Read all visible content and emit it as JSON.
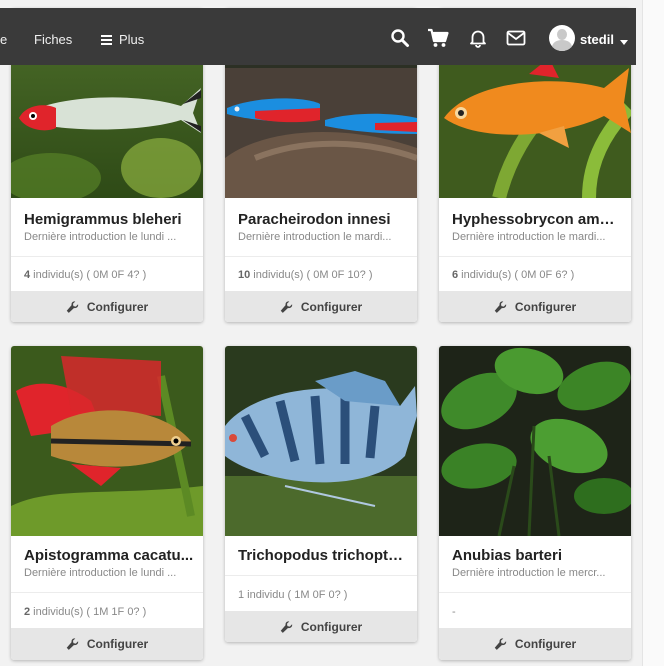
{
  "navbar": {
    "partial_item": "e",
    "fiches_label": "Fiches",
    "plus_label": "Plus",
    "username": "stedil",
    "icons": [
      "search-icon",
      "cart-icon",
      "bell-icon",
      "envelope-icon",
      "user-avatar",
      "caret-down-icon"
    ],
    "background": "#3a3a3a"
  },
  "cards": [
    {
      "title": "Hemigrammus bleheri",
      "subtitle": "Dernière introduction le lundi ...",
      "count_bold": "4",
      "count_rest": " individu(s) ( 0M 0F 4? )",
      "configure": "Configurer"
    },
    {
      "title": "Paracheirodon innesi",
      "subtitle": "Dernière introduction le mardi...",
      "count_bold": "10",
      "count_rest": " individu(s) ( 0M 0F 10? )",
      "configure": "Configurer"
    },
    {
      "title": "Hyphessobrycon aman...",
      "subtitle": "Dernière introduction le mardi...",
      "count_bold": "6",
      "count_rest": " individu(s) ( 0M 0F 6? )",
      "configure": "Configurer"
    },
    {
      "title": "Apistogramma cacatu...",
      "subtitle": "Dernière introduction le lundi ...",
      "count_bold": "2",
      "count_rest": " individu(s) ( 1M 1F 0? )",
      "configure": "Configurer"
    },
    {
      "title": "Trichopodus trichopte...",
      "subtitle": "",
      "count_bold": "",
      "count_rest": "1 individu ( 1M 0F 0? )",
      "configure": "Configurer"
    },
    {
      "title": "Anubias barteri",
      "subtitle": "Dernière introduction le mercr...",
      "count_bold": "",
      "count_rest": "-",
      "configure": "Configurer"
    }
  ],
  "colors": {
    "config_bg": "#e6e6e6",
    "page_bg": "#f2f2f2"
  }
}
